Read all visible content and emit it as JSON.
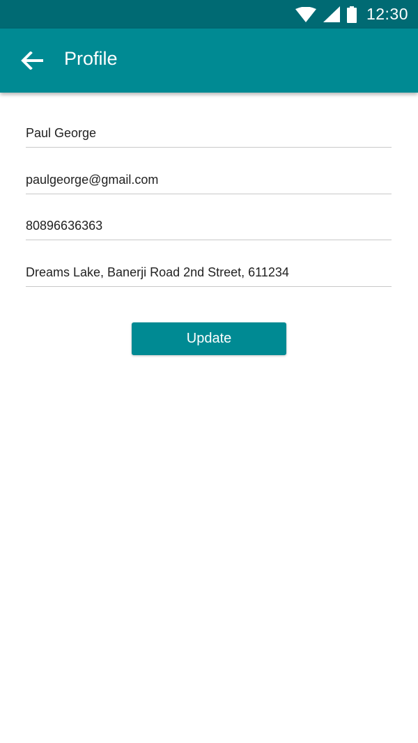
{
  "status_bar": {
    "time": "12:30",
    "icons": [
      "wifi-icon",
      "cell-signal-icon",
      "battery-icon"
    ]
  },
  "app_bar": {
    "title": "Profile",
    "back_icon": "arrow-left-icon"
  },
  "form": {
    "name": "Paul George",
    "email": "paulgeorge@gmail.com",
    "phone": "80896636363",
    "address": "Dreams Lake, Banerji Road 2nd Street, 611234"
  },
  "actions": {
    "update_label": "Update"
  },
  "colors": {
    "status_bar": "#006a73",
    "app_bar": "#008a93",
    "button": "#008a93"
  }
}
